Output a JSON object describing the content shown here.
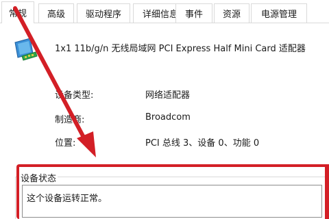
{
  "tabs": [
    {
      "label": "常规",
      "active": true
    },
    {
      "label": "高级",
      "active": false
    },
    {
      "label": "驱动程序",
      "active": false
    },
    {
      "label": "详细信息",
      "active": false
    },
    {
      "label": "事件",
      "active": false
    },
    {
      "label": "资源",
      "active": false
    },
    {
      "label": "电源管理",
      "active": false
    }
  ],
  "device": {
    "icon": "network-adapter-icon",
    "name": "1x1 11b/g/n 无线局域网 PCI Express Half Mini Card 适配器"
  },
  "properties": [
    {
      "label": "设备类型:",
      "value": "网络适配器"
    },
    {
      "label": "制造商:",
      "value": "Broadcom"
    },
    {
      "label": "位置:",
      "value": "PCI 总线 3、设备 0、功能 0"
    }
  ],
  "status": {
    "title": "设备状态",
    "text": "这个设备运转正常。"
  },
  "annotation": {
    "color": "#d31f26"
  }
}
